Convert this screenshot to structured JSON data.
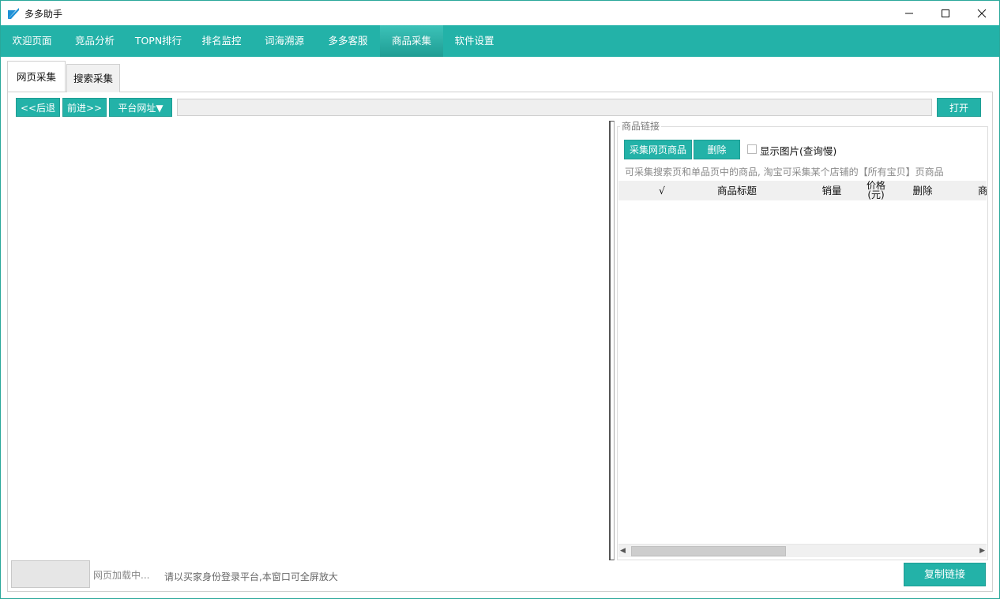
{
  "window": {
    "title": "多多助手",
    "controls": {
      "minimize": "—",
      "maximize": "☐",
      "close": "✕"
    }
  },
  "nav": {
    "items": [
      {
        "label": "欢迎页面"
      },
      {
        "label": "竞品分析"
      },
      {
        "label": "TOPN排行"
      },
      {
        "label": "排名监控"
      },
      {
        "label": "词海溯源"
      },
      {
        "label": "多多客服"
      },
      {
        "label": "商品采集",
        "active": true
      },
      {
        "label": "软件设置"
      }
    ]
  },
  "tabs": [
    {
      "label": "网页采集",
      "active": true
    },
    {
      "label": "搜索采集"
    }
  ],
  "toolbar": {
    "back_label": "<<后退",
    "forward_label": "前进>>",
    "platform_label": "平台网址▼",
    "url_value": "",
    "open_label": "打开"
  },
  "product_links": {
    "group_title": "商品链接",
    "collect_label": "采集网页商品",
    "delete_label": "删除",
    "show_images_label": "显示图片(查询慢)",
    "show_images_checked": false,
    "hint": "可采集搜索页和单品页中的商品, 淘宝可采集某个店铺的【所有宝贝】页商品",
    "columns": [
      "√",
      "商品标题",
      "销量",
      "价格(元)",
      "删除",
      "商"
    ]
  },
  "status": {
    "loading": "网页加载中...",
    "hint": "请以买家身份登录平台,本窗口可全屏放大",
    "copy_label": "复制链接"
  },
  "colors": {
    "accent": "#23b2a8",
    "accent_dark": "#1f9d94"
  }
}
